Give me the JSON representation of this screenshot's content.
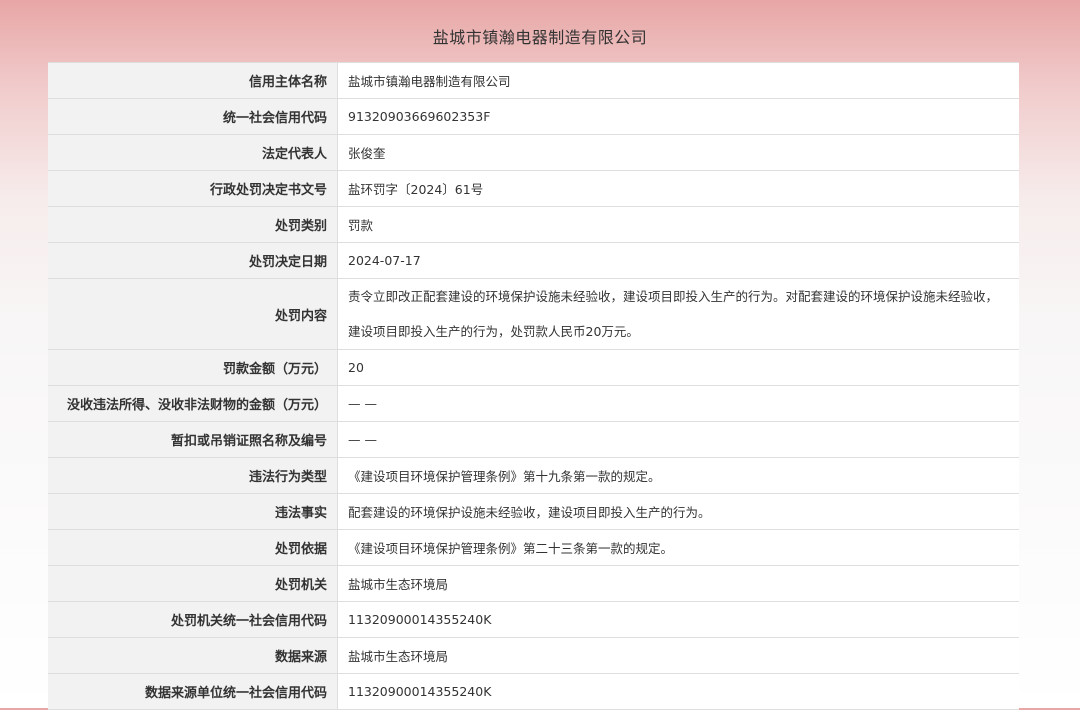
{
  "title": "盐城市镇瀚电器制造有限公司",
  "rows": [
    {
      "label": "信用主体名称",
      "value": "盐城市镇瀚电器制造有限公司"
    },
    {
      "label": "统一社会信用代码",
      "value": "91320903669602353F"
    },
    {
      "label": "法定代表人",
      "value": "张俊奎"
    },
    {
      "label": "行政处罚决定书文号",
      "value": "盐环罚字〔2024〕61号"
    },
    {
      "label": "处罚类别",
      "value": "罚款"
    },
    {
      "label": "处罚决定日期",
      "value": "2024-07-17"
    },
    {
      "label": "处罚内容",
      "value": "责令立即改正配套建设的环境保护设施未经验收，建设项目即投入生产的行为。对配套建设的环境保护设施未经验收，建设项目即投入生产的行为，处罚款人民币20万元。"
    },
    {
      "label": "罚款金额（万元）",
      "value": "20"
    },
    {
      "label": "没收违法所得、没收非法财物的金额（万元）",
      "value": "— —"
    },
    {
      "label": "暂扣或吊销证照名称及编号",
      "value": "— —"
    },
    {
      "label": "违法行为类型",
      "value": "《建设项目环境保护管理条例》第十九条第一款的规定。"
    },
    {
      "label": "违法事实",
      "value": "配套建设的环境保护设施未经验收，建设项目即投入生产的行为。"
    },
    {
      "label": "处罚依据",
      "value": "《建设项目环境保护管理条例》第二十三条第一款的规定。"
    },
    {
      "label": "处罚机关",
      "value": "盐城市生态环境局"
    },
    {
      "label": "处罚机关统一社会信用代码",
      "value": "11320900014355240K"
    },
    {
      "label": "数据来源",
      "value": "盐城市生态环境局"
    },
    {
      "label": "数据来源单位统一社会信用代码",
      "value": "11320900014355240K"
    }
  ]
}
